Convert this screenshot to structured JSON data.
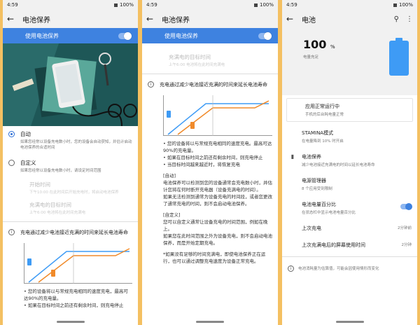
{
  "status": {
    "time": "4:59",
    "battery": "100%"
  },
  "p1": {
    "title": "电池保养",
    "use_label": "使用电池保养",
    "auto_title": "自动",
    "auto_sub": "如果您经常以设备充电数小时，您的设备会自动获知，并估计启动电池保养的合适时间",
    "custom_title": "自定义",
    "custom_sub": "如果您经常以设备充电数小时，请设定时间范围",
    "start_title": "开始时间",
    "start_sub": "下午10:00 在此时间后开始充电时，将启动电池保养",
    "end_title": "充满电的目标时间",
    "end_sub": "上午6:00 电池将在此时间充满电",
    "info_text": "充电通过减少电池接近充满的时间来延长电池寿命",
    "bullets": [
      "• 您的设备将以与常规充电相同的速度充电，最高可达90%的充电量。",
      "• 如果在目标时间之前还有剩余时间，则充电停止"
    ]
  },
  "p2": {
    "title": "电池保养",
    "use_label": "使用电池保养",
    "top_fade": "充满电的目标时间",
    "top_fade_sub": "上午6:00 电池将在此时间充满电",
    "info_text": "充电通过减少电池接近充满的时间来延长电池寿命",
    "bullets": [
      "• 您的设备将以与常规充电相同的速度充电。最高可达90%的充电量。",
      "• 如果在目标时间之前还有剩余时间，则充电停止",
      "• 当目标时间越来越近时，将恢复充电"
    ],
    "auto_head": "[自动]",
    "auto_para": "电池保养可以检测到您的设备通常会充电数小时，并估计您将在何时断开充电器（设备充满电的时间）。",
    "auto_para2": "如果无法检测到通常为设备充电的时间段，或者您更改了通常充电的时间，则不会启动电池保养。",
    "custom_head": "[自定义]",
    "custom_para": "您可以自定义通常让设备充电的时间范围，例如在晚上。",
    "custom_para2": "如果您在此时间范围之外为设备充电，则不会启动电池保养，而是开始定期充电。",
    "note": "*如果没有足够的时间充满电，即使电池保养正在运行，也可以通过调整充电速度为设备正常充电。"
  },
  "p3": {
    "title": "电池",
    "percent": "100",
    "percent_unit": "%",
    "charged": "电量充足",
    "card_title": "应用正常运行中",
    "card_sub": "手机的后台耗电量正常",
    "items": [
      {
        "title": "STAMINA模式",
        "sub": "在电量降到 10% 时开启",
        "right": ""
      },
      {
        "title": "电池保养",
        "sub": "减少电池接近充满电的时间以延长电池寿命",
        "right": ""
      },
      {
        "title": "电源管理器",
        "sub": "8 个应用受到限制",
        "right": ""
      },
      {
        "title": "电池电量百分比",
        "sub": "在状态栏中显示电池电量百分比",
        "right": ""
      },
      {
        "title": "上次充电",
        "sub": "",
        "right": "2分钟前"
      },
      {
        "title": "上次充满电后的屏幕使用时间",
        "sub": "",
        "right": "2分钟"
      }
    ],
    "footer": "电池消耗量为估算值，可能会因使用情形而变化"
  },
  "colors": {
    "accent": "#3e82e0",
    "background": "#f4c062",
    "battery": "#3e9bf5"
  }
}
